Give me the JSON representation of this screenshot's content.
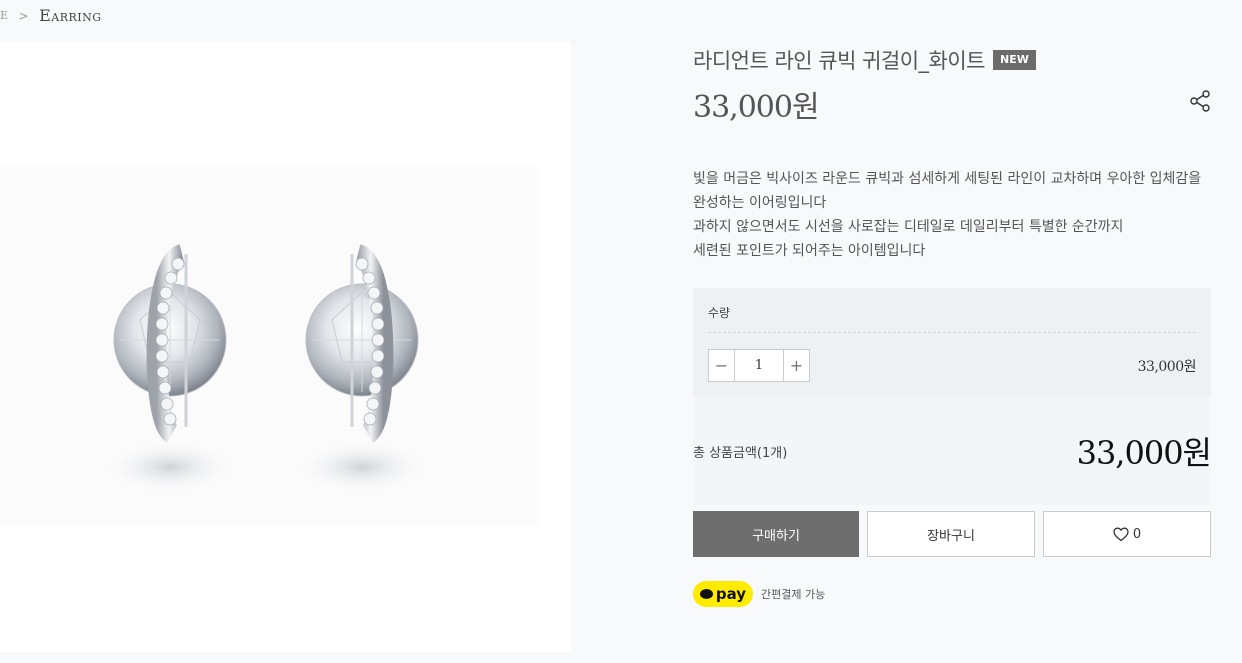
{
  "breadcrumb": {
    "prev": "E",
    "separator": ">",
    "current": "Earring"
  },
  "product": {
    "title": "라디언트 라인 큐빅 귀걸이_화이트",
    "badge": "NEW",
    "price": "33,000원",
    "description": [
      "빛을 머금은 빅사이즈 라운드 큐빅과 섬세하게 세팅된 라인이 교차하며 우아한 입체감을",
      "완성하는 이어링입니다",
      "과하지 않으면서도 시선을 사로잡는 디테일로 데일리부터 특별한 순간까지",
      "세련된 포인트가 되어주는 아이템입니다"
    ]
  },
  "quantity": {
    "label": "수량",
    "value": "1",
    "minus": "−",
    "plus": "+",
    "line_price": "33,000원"
  },
  "total": {
    "label": "총 상품금액(1개)",
    "price": "33,000원"
  },
  "actions": {
    "buy": "구매하기",
    "cart": "장바구니",
    "wish_count": "0"
  },
  "kakaopay": {
    "label": "pay",
    "note": "간편결제 가능"
  },
  "icons": {
    "share": "share-icon",
    "heart": "heart-icon",
    "kakao": "kakao-bubble-icon"
  },
  "colors": {
    "buy_button": "#6e6e6e",
    "badge": "#6b6b6b",
    "kakao_yellow": "#ffeb00"
  }
}
